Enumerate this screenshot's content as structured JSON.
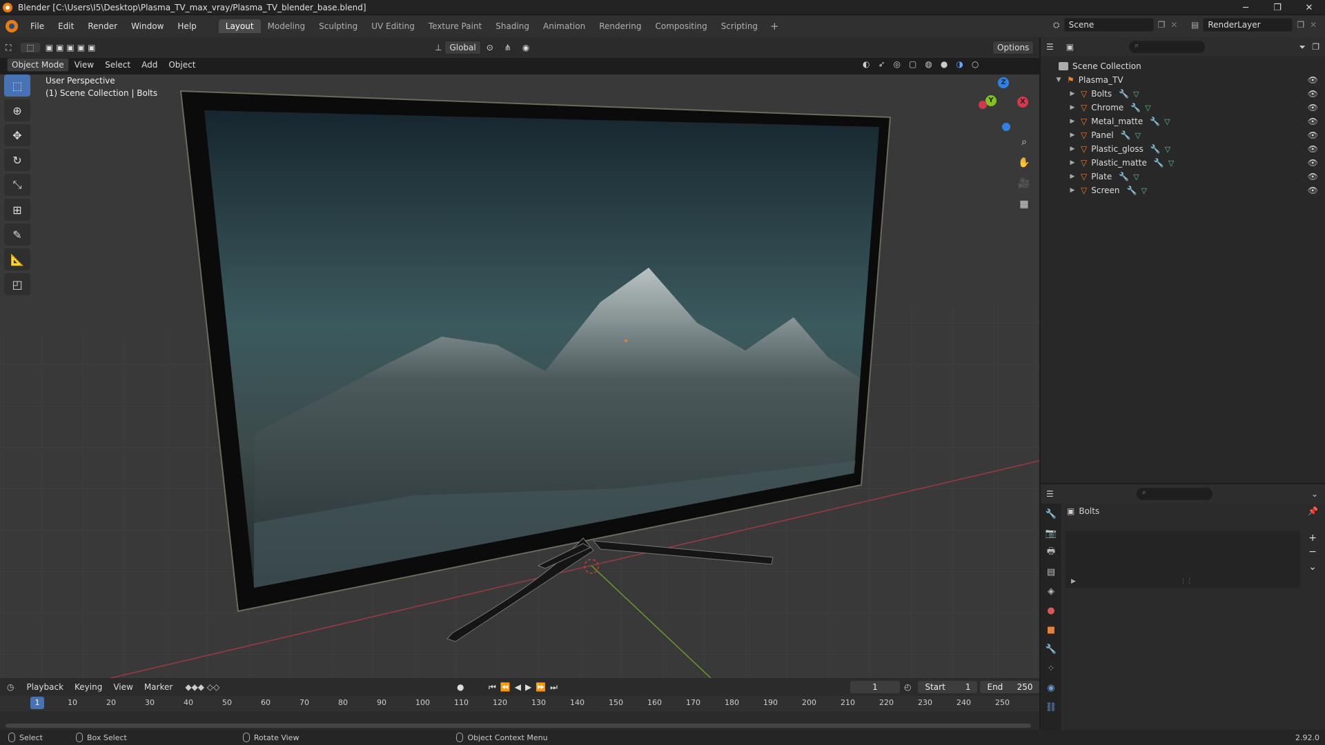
{
  "window": {
    "title": "Blender [C:\\Users\\I5\\Desktop\\Plasma_TV_max_vray/Plasma_TV_blender_base.blend]",
    "minimize": "─",
    "maximize": "❐",
    "close": "✕"
  },
  "menus": [
    "File",
    "Edit",
    "Render",
    "Window",
    "Help"
  ],
  "workspaces": [
    "Layout",
    "Modeling",
    "Sculpting",
    "UV Editing",
    "Texture Paint",
    "Shading",
    "Animation",
    "Rendering",
    "Compositing",
    "Scripting"
  ],
  "workspace_add": "+",
  "scene": {
    "label": "Scene"
  },
  "view_layer": {
    "label": "RenderLayer"
  },
  "tool_header": {
    "orientation": "Global",
    "options": "Options"
  },
  "viewport_header": {
    "mode": "Object Mode",
    "menus": [
      "View",
      "Select",
      "Add",
      "Object"
    ]
  },
  "viewport": {
    "perspective": "User Perspective",
    "collection_info": "(1) Scene Collection | Bolts",
    "gizmo": {
      "z": "Z",
      "y": "Y",
      "x": "X"
    }
  },
  "outliner": {
    "root": "Scene Collection",
    "collection": "Plasma_TV",
    "objects": [
      "Bolts",
      "Chrome",
      "Metal_matte",
      "Panel",
      "Plastic_gloss",
      "Plastic_matte",
      "Plate",
      "Screen"
    ],
    "search_icon": "⌕"
  },
  "properties": {
    "active_object": "Bolts",
    "add": "+",
    "remove": "−",
    "more": "⌄"
  },
  "timeline": {
    "menus": [
      "Playback",
      "Keying",
      "View",
      "Marker"
    ],
    "current_frame": "1",
    "start_label": "Start",
    "start_value": "1",
    "end_label": "End",
    "end_value": "250",
    "ruler_labels": [
      "1",
      "10",
      "20",
      "30",
      "40",
      "50",
      "60",
      "70",
      "80",
      "90",
      "100",
      "110",
      "120",
      "130",
      "140",
      "150",
      "160",
      "170",
      "180",
      "190",
      "200",
      "210",
      "220",
      "230",
      "240",
      "250"
    ]
  },
  "statusbar": {
    "items": [
      "Select",
      "Box Select",
      "Rotate View",
      "Object Context Menu"
    ],
    "version": "2.92.0"
  },
  "colors": {
    "accent": "#4772b3",
    "object_orange": "#e8813a",
    "axis_x": "#d1394d",
    "axis_y": "#84c126",
    "axis_z": "#2f82e3"
  }
}
